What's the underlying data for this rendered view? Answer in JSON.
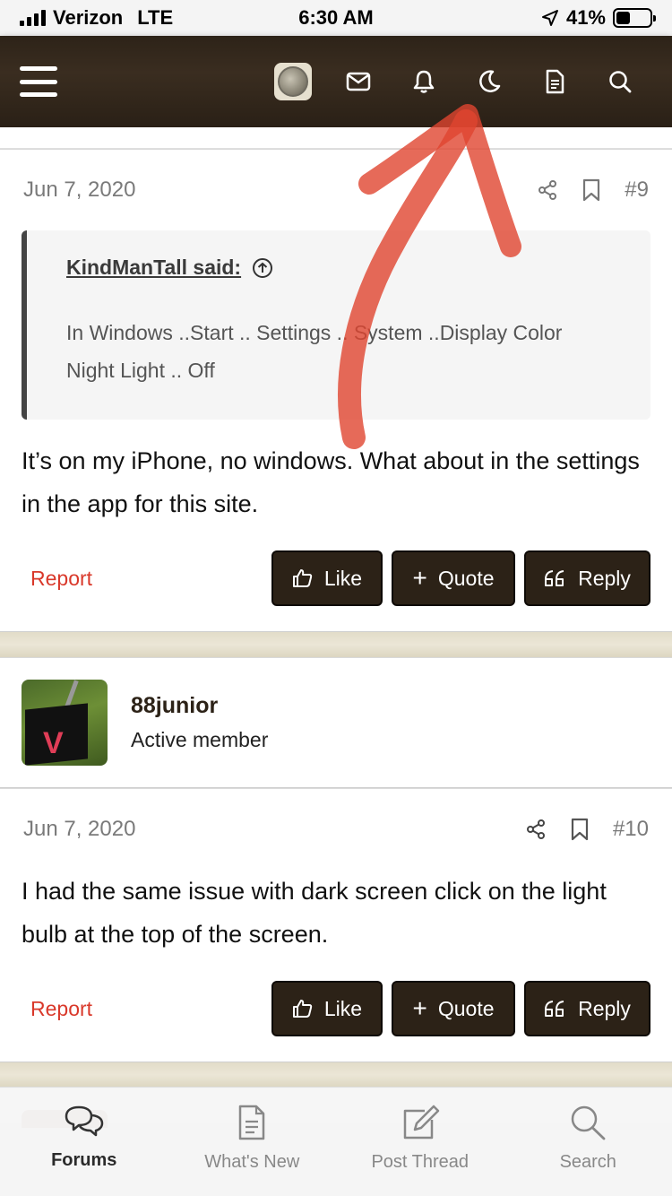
{
  "status": {
    "carrier": "Verizon",
    "network": "LTE",
    "time": "6:30 AM",
    "battery": "41%",
    "battery_level": 0.41
  },
  "header": {
    "icons": [
      "menu-icon",
      "avatar",
      "envelope-icon",
      "bell-icon",
      "moon-icon",
      "document-icon",
      "search-icon"
    ]
  },
  "posts": [
    {
      "date": "Jun 7, 2020",
      "number": "#9",
      "quote": {
        "author": "KindManTall said:",
        "text": "In Windows ..Start .. Settings .. System ..Display Color Night Light .. Off"
      },
      "body": "It’s on my iPhone, no windows. What about in the settings in the app for this site.",
      "report": "Report",
      "like": "Like",
      "quote_btn": "Quote",
      "reply": "Reply"
    },
    {
      "date": "Jun 7, 2020",
      "number": "#10",
      "body": "I had the same issue with dark screen click on the light bulb at the top of the screen.",
      "report": "Report",
      "like": "Like",
      "quote_btn": "Quote",
      "reply": "Reply"
    }
  ],
  "member": {
    "username": "88junior",
    "title": "Active member"
  },
  "tabs": [
    {
      "label": "Forums",
      "icon": "chat-bubbles-icon",
      "active": true
    },
    {
      "label": "What's New",
      "icon": "document-icon",
      "active": false
    },
    {
      "label": "Post Thread",
      "icon": "edit-icon",
      "active": false
    },
    {
      "label": "Search",
      "icon": "search-icon",
      "active": false
    }
  ],
  "colors": {
    "header_bg": "#2d2318",
    "button_bg": "#2c2217",
    "report": "#d9382a",
    "annotation_arrow": "#e0452f"
  }
}
